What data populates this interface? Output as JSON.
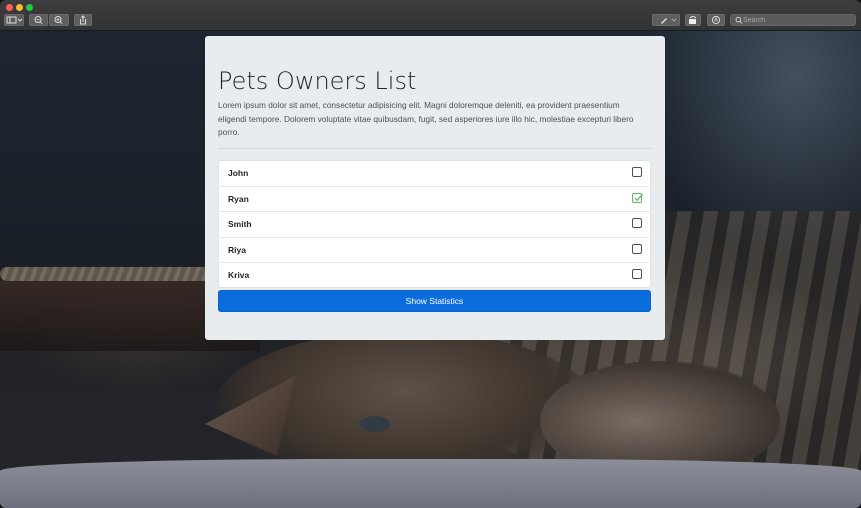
{
  "toolbar": {
    "search": {
      "placeholder": "Search"
    },
    "icons": [
      "sidebar-toggle-icon",
      "chevron-down-icon",
      "zoom-out-icon",
      "zoom-in-icon",
      "share-icon",
      "pen-icon",
      "rotate-icon",
      "markup-icon",
      "search-icon"
    ]
  },
  "card": {
    "title": "Pets Owners List",
    "lead": "Lorem ipsum dolor sit amet, consectetur adipisicing elit. Magni doloremque deleniti, ea provident praesentium eligendi tempore. Dolorem voluptate vitae quibusdam, fugit, sed asperiores iure illo hic, molestiae excepturi libero porro.",
    "owners": [
      {
        "name": "John",
        "checked": false
      },
      {
        "name": "Ryan",
        "checked": true
      },
      {
        "name": "Smith",
        "checked": false
      },
      {
        "name": "Riya",
        "checked": false
      },
      {
        "name": "Kriva",
        "checked": false
      }
    ],
    "button_label": "Show Statistics"
  },
  "colors": {
    "accent": "#0b6ddc",
    "check_green": "#5cb85c",
    "card_bg": "#e9ecef"
  }
}
